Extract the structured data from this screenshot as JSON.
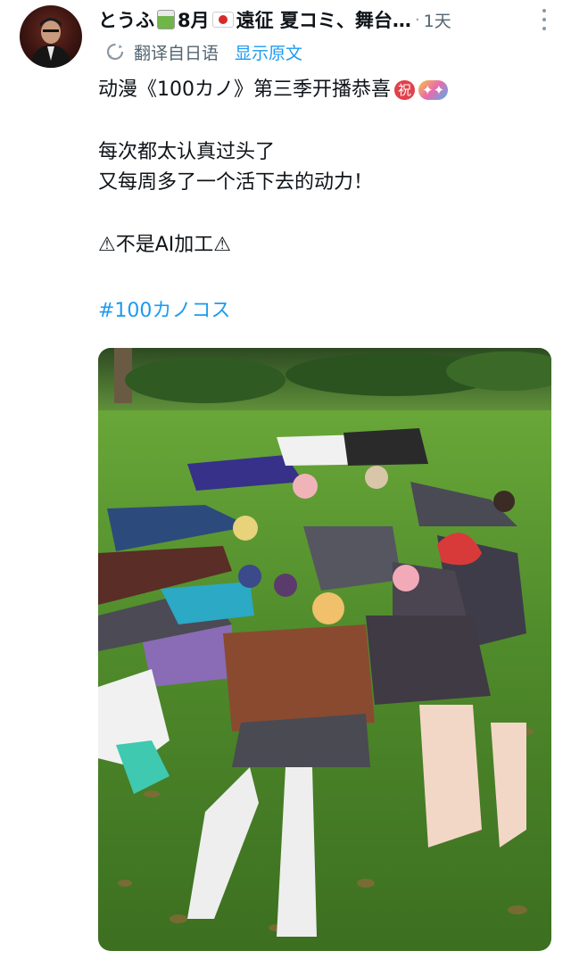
{
  "post": {
    "display_name": "とうふ",
    "name_suffix_month": "8月",
    "name_suffix_rest": "遠征 夏コミ、舞台…",
    "dot": "·",
    "timestamp": "1天",
    "translate_label": "翻译自日语",
    "show_original": "显示原文",
    "text_line1_a": "动漫《100カノ》第三季开播恭喜",
    "text_line1_chip": "祝",
    "text_line2": "每次都太认真过头了",
    "text_line3": "又每周多了一个活下去的动力！",
    "text_line4": "⚠不是AI加工⚠",
    "hashtag": "#100カノコス"
  },
  "icons": [
    "avatar",
    "milk-carton-emoji",
    "japan-flag-emoji",
    "more-vertical-icon",
    "translate-icon",
    "celebration-emoji"
  ],
  "colors": {
    "link": "#1d9bf0",
    "secondary_text": "#536471",
    "primary_text": "#0f1419",
    "grass": "#4f8a2b"
  }
}
